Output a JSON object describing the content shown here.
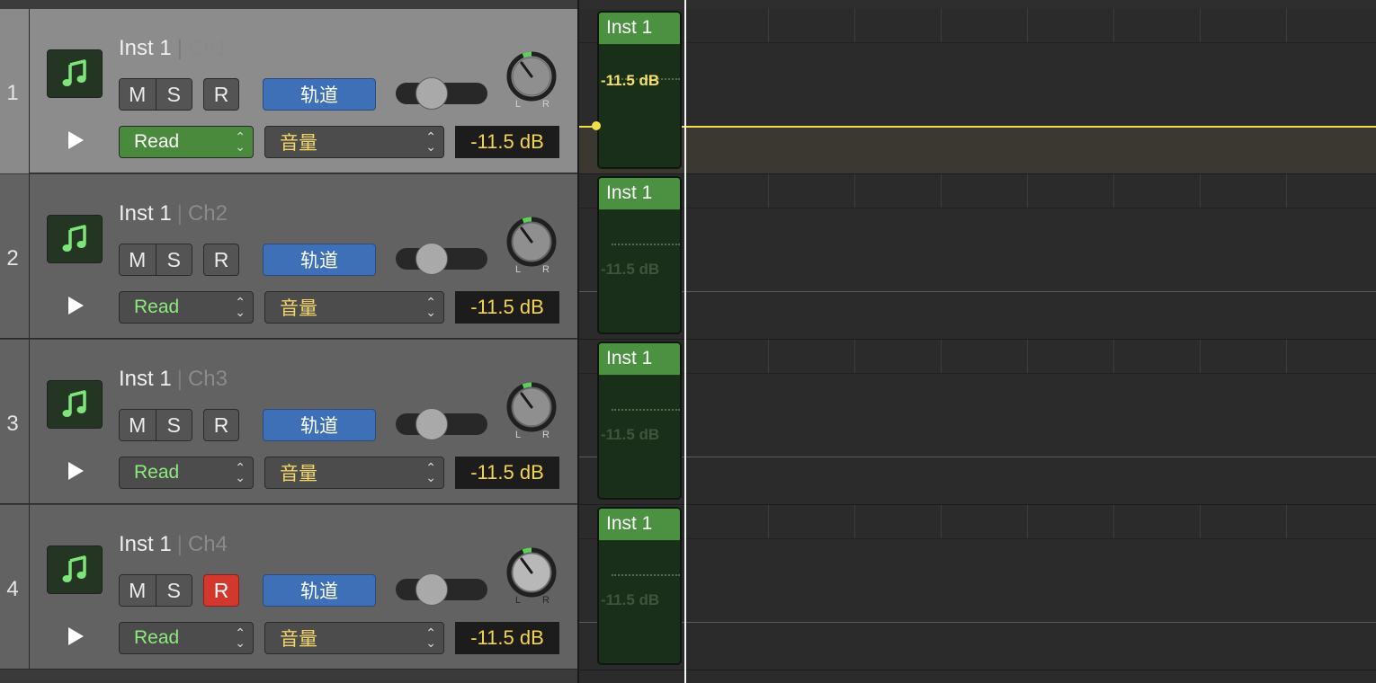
{
  "tracks": [
    {
      "number": "1",
      "name": "Inst 1",
      "separator": "|",
      "channel": "Ch1",
      "mute_label": "M",
      "solo_label": "S",
      "record_label": "R",
      "record_active": false,
      "track_button_label": "轨道",
      "automation_mode": "Read",
      "automation_param": "音量",
      "volume_readout": "-11.5 dB",
      "pan_left": "L",
      "pan_right": "R",
      "region_label": "Inst 1",
      "region_value": "-11.5 dB",
      "selected": true
    },
    {
      "number": "2",
      "name": "Inst 1",
      "separator": "|",
      "channel": "Ch2",
      "mute_label": "M",
      "solo_label": "S",
      "record_label": "R",
      "record_active": false,
      "track_button_label": "轨道",
      "automation_mode": "Read",
      "automation_param": "音量",
      "volume_readout": "-11.5 dB",
      "pan_left": "L",
      "pan_right": "R",
      "region_label": "Inst 1",
      "region_value": "-11.5 dB",
      "selected": false
    },
    {
      "number": "3",
      "name": "Inst 1",
      "separator": "|",
      "channel": "Ch3",
      "mute_label": "M",
      "solo_label": "S",
      "record_label": "R",
      "record_active": false,
      "track_button_label": "轨道",
      "automation_mode": "Read",
      "automation_param": "音量",
      "volume_readout": "-11.5 dB",
      "pan_left": "L",
      "pan_right": "R",
      "region_label": "Inst 1",
      "region_value": "-11.5 dB",
      "selected": false
    },
    {
      "number": "4",
      "name": "Inst 1",
      "separator": "|",
      "channel": "Ch4",
      "mute_label": "M",
      "solo_label": "S",
      "record_label": "R",
      "record_active": true,
      "track_button_label": "轨道",
      "automation_mode": "Read",
      "automation_param": "音量",
      "volume_readout": "-11.5 dB",
      "pan_left": "L",
      "pan_right": "R",
      "region_label": "Inst 1",
      "region_value": "-11.5 dB",
      "selected": false
    }
  ],
  "colors": {
    "accent_green": "#4b9141",
    "record_red": "#d2382d",
    "track_button_blue": "#3e70b8",
    "automation_yellow": "#f2dd4a",
    "read_text_green": "#8dea7e",
    "header_selected": "#8c8c8c",
    "header_default": "#626262"
  },
  "icons": {
    "instrument": "music-note-icon",
    "play": "play-icon",
    "selector": "chevron-updown-icon",
    "pan": "pan-knob-icon"
  }
}
